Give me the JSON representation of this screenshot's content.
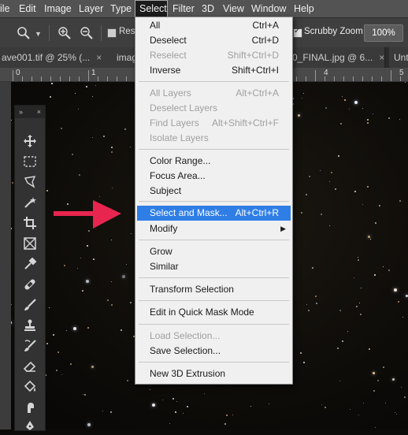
{
  "menubar": {
    "items": [
      "ile",
      "Edit",
      "Image",
      "Layer",
      "Type",
      "Select",
      "Filter",
      "3D",
      "View",
      "Window",
      "Help"
    ]
  },
  "options": {
    "resize_label": "Resi",
    "scrubby_label": "Scrubby Zoom",
    "zoom_value": "100%"
  },
  "tabs": [
    {
      "label": "ave001.tif @ 25% (..."
    },
    {
      "label": "imag"
    },
    {
      "label": "0_FINAL.jpg @ 6..."
    },
    {
      "label": "Unt"
    }
  ],
  "ruler": {
    "numbers": [
      "0",
      "1",
      "4",
      "5"
    ]
  },
  "select_menu": {
    "items": [
      {
        "label": "All",
        "shortcut": "Ctrl+A",
        "state": "enabled"
      },
      {
        "label": "Deselect",
        "shortcut": "Ctrl+D",
        "state": "enabled"
      },
      {
        "label": "Reselect",
        "shortcut": "Shift+Ctrl+D",
        "state": "disabled"
      },
      {
        "label": "Inverse",
        "shortcut": "Shift+Ctrl+I",
        "state": "enabled"
      },
      {
        "label": "All Layers",
        "shortcut": "Alt+Ctrl+A",
        "state": "disabled"
      },
      {
        "label": "Deselect Layers",
        "shortcut": "",
        "state": "disabled"
      },
      {
        "label": "Find Layers",
        "shortcut": "Alt+Shift+Ctrl+F",
        "state": "disabled"
      },
      {
        "label": "Isolate Layers",
        "shortcut": "",
        "state": "disabled"
      },
      {
        "label": "Color Range...",
        "shortcut": "",
        "state": "enabled"
      },
      {
        "label": "Focus Area...",
        "shortcut": "",
        "state": "enabled"
      },
      {
        "label": "Subject",
        "shortcut": "",
        "state": "enabled"
      },
      {
        "label": "Select and Mask...",
        "shortcut": "Alt+Ctrl+R",
        "state": "highlighted"
      },
      {
        "label": "Modify",
        "shortcut": "",
        "state": "submenu"
      },
      {
        "label": "Grow",
        "shortcut": "",
        "state": "enabled"
      },
      {
        "label": "Similar",
        "shortcut": "",
        "state": "enabled"
      },
      {
        "label": "Transform Selection",
        "shortcut": "",
        "state": "enabled"
      },
      {
        "label": "Edit in Quick Mask Mode",
        "shortcut": "",
        "state": "enabled"
      },
      {
        "label": "Load Selection...",
        "shortcut": "",
        "state": "disabled"
      },
      {
        "label": "Save Selection...",
        "shortcut": "",
        "state": "enabled"
      },
      {
        "label": "New 3D Extrusion",
        "shortcut": "",
        "state": "enabled"
      }
    ]
  },
  "toolbar": {
    "collapse_glyph": "»",
    "close_glyph": "×",
    "tools": [
      "move-tool",
      "marquee-tool",
      "lasso-tool",
      "magic-wand-tool",
      "crop-tool",
      "frame-tool",
      "eyedropper-tool",
      "healing-brush-tool",
      "brush-tool",
      "clone-stamp-tool",
      "history-brush-tool",
      "eraser-tool",
      "paint-bucket-tool",
      "smudge-tool",
      "pen-tool"
    ]
  },
  "colors": {
    "highlight": "#2f7ee6",
    "arrow": "#e8254f",
    "menubar": "#535353"
  }
}
